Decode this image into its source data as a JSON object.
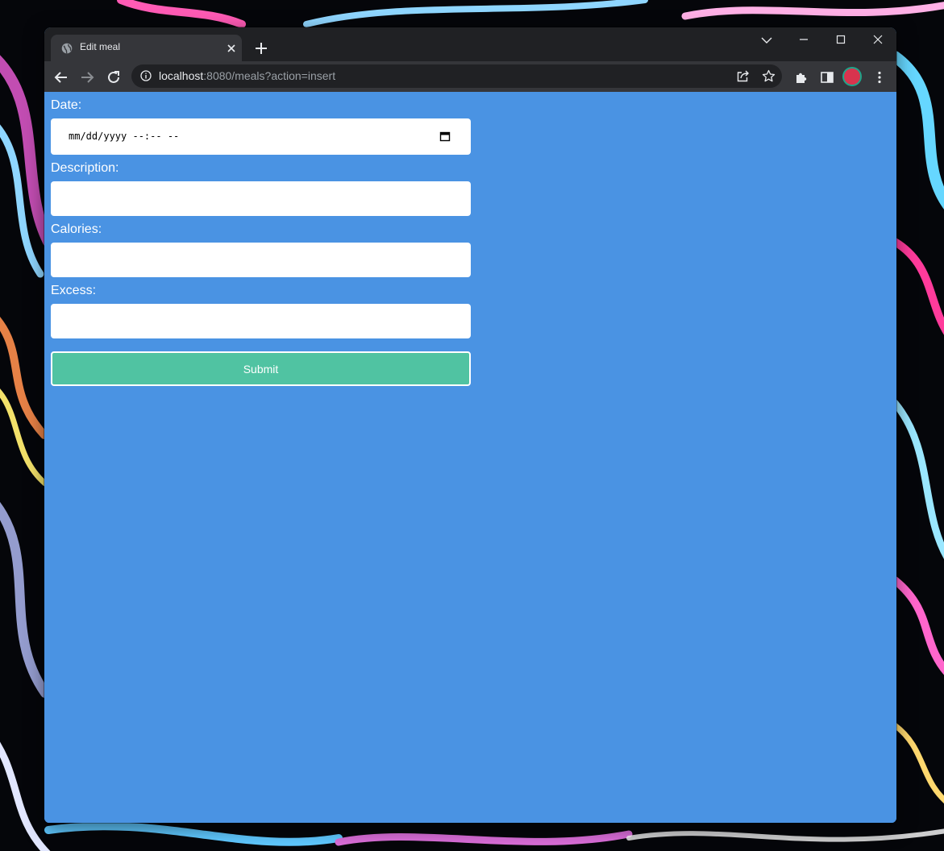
{
  "browser": {
    "tab_title": "Edit meal",
    "url_host": "localhost",
    "url_rest": ":8080/meals?action=insert",
    "icons": [
      "globe-icon",
      "close-icon",
      "plus-icon",
      "chevron-down-icon",
      "minimize-icon",
      "maximize-icon",
      "window-close-icon",
      "back-arrow-icon",
      "forward-arrow-icon",
      "reload-icon",
      "info-icon",
      "share-icon",
      "star-icon",
      "puzzle-icon",
      "side-panel-icon",
      "kebab-menu-icon"
    ],
    "profile_colors": {
      "fill": "#d8344e",
      "ring": "#1ea58a"
    }
  },
  "form": {
    "date_label": "Date:",
    "date_placeholder": "mm/dd/yyyy --:-- --",
    "description_label": "Description:",
    "description_value": "",
    "calories_label": "Calories:",
    "calories_value": "",
    "excess_label": "Excess:",
    "excess_value": "",
    "submit_label": "Submit"
  },
  "colors": {
    "page_background": "#4a93e3",
    "submit_background": "#50c3a2",
    "chrome_dark": "#202124",
    "chrome_toolbar": "#35363a"
  }
}
